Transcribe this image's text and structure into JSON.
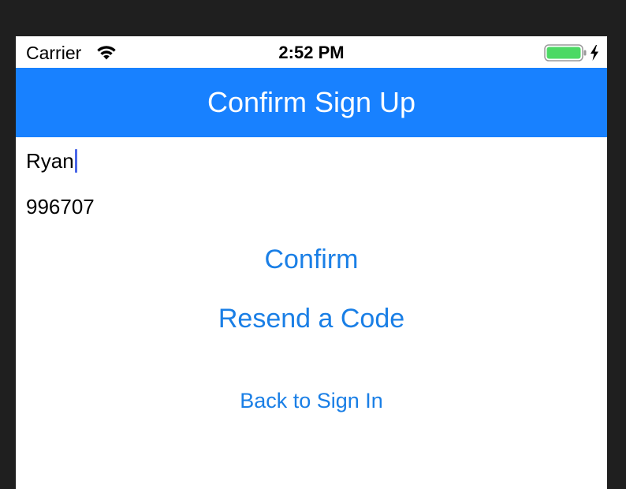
{
  "status_bar": {
    "carrier": "Carrier",
    "time": "2:52 PM",
    "battery_level": 1.0,
    "battery_color": "#4cd964",
    "charging": true
  },
  "nav_bar": {
    "title": "Confirm Sign Up",
    "background_color": "#1881ff"
  },
  "form": {
    "username_value": "Ryan",
    "code_value": "996707"
  },
  "buttons": {
    "confirm_label": "Confirm",
    "resend_label": "Resend a Code",
    "back_label": "Back to Sign In"
  },
  "colors": {
    "link": "#1a7fe6",
    "caret": "#4a67e8"
  },
  "icons": {
    "wifi": "wifi-icon",
    "battery": "battery-icon",
    "charging": "charging-bolt-icon"
  }
}
